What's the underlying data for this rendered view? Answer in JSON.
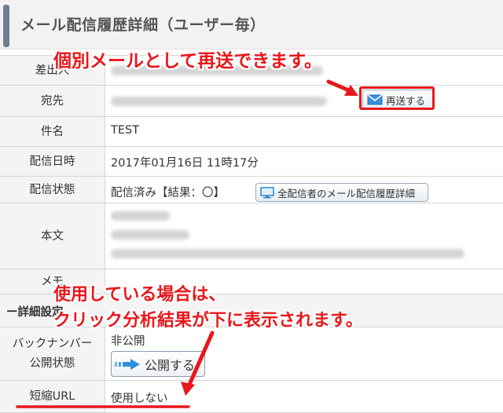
{
  "header": {
    "title": "メール配信履歴詳細（ユーザー毎）"
  },
  "rows": {
    "sender": {
      "label": "差出人"
    },
    "recipient": {
      "label": "宛先",
      "resend_button": "再送する"
    },
    "subject": {
      "label": "件名",
      "value": "TEST"
    },
    "sent_at": {
      "label": "配信日時",
      "value": "2017年01月16日 11時17分"
    },
    "status": {
      "label": "配信状態",
      "value": "配信済み【結果：〇】",
      "all_history_button": "全配信者のメール配信履歴詳細"
    },
    "body": {
      "label": "本文"
    },
    "memo": {
      "label": "メモ"
    },
    "section": {
      "label": "ー詳細設定"
    },
    "backnumber": {
      "label_line1": "バックナンバー",
      "label_line2": "公開状態",
      "value": "非公開",
      "publish_button": "公開する"
    },
    "short_url": {
      "label": "短縮URL",
      "value": "使用しない"
    }
  },
  "annotations": {
    "top": "個別メールとして再送できます。",
    "bottom_line1": "使用している場合は、",
    "bottom_line2": "クリック分析結果が下に表示されます。"
  },
  "icons": {
    "resend": "envelope-icon",
    "all_history": "monitor-icon",
    "publish": "arrow-right-icon"
  },
  "colors": {
    "annotation": "#e8171b",
    "label_bg": "#f4f4f4",
    "header_bar": "#6e7f91"
  }
}
